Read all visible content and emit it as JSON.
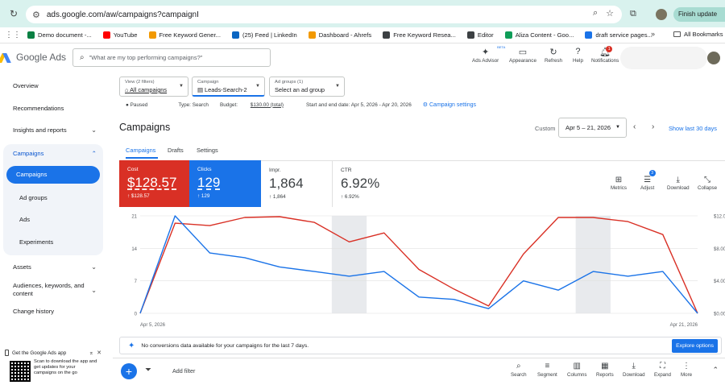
{
  "browser": {
    "url": "ads.google.com/aw/campaigns?campaignI",
    "finish_update": "Finish update"
  },
  "bookmarks": [
    {
      "label": "Demo document -...",
      "color": "#0b8043"
    },
    {
      "label": "YouTube",
      "color": "#ff0000"
    },
    {
      "label": "Free Keyword Gener...",
      "color": "#f29900"
    },
    {
      "label": "(25) Feed | LinkedIn",
      "color": "#0a66c2"
    },
    {
      "label": "Dashboard - Ahrefs",
      "color": "#f29900"
    },
    {
      "label": "Free Keyword Resea...",
      "color": "#3c4043"
    },
    {
      "label": "Editor",
      "color": "#3c4043"
    },
    {
      "label": "Aliza Content - Goo...",
      "color": "#0f9d58"
    },
    {
      "label": "draft service pages...",
      "color": "#1a73e8"
    }
  ],
  "bookmarks_all": "All Bookmarks",
  "header": {
    "brand": "Google Ads",
    "search_placeholder": "\"What are my top performing campaigns?\"",
    "tools": {
      "advisor": "Ads Advisor",
      "advisor_badge": "BETA",
      "appearance": "Appearance",
      "refresh": "Refresh",
      "help": "Help",
      "notifications": "Notifications",
      "notif_count": "1"
    }
  },
  "sidebar": {
    "overview": "Overview",
    "recommendations": "Recommendations",
    "insights": "Insights and reports",
    "campaigns_group": "Campaigns",
    "campaigns": "Campaigns",
    "ad_groups": "Ad groups",
    "ads": "Ads",
    "experiments": "Experiments",
    "assets": "Assets",
    "audiences": "Audiences, keywords, and content",
    "change_history": "Change history",
    "promo_title": "Get the Google Ads app",
    "promo_text": "Scan to download the app and get updates for your campaigns on the go"
  },
  "filters": {
    "view_label": "View (2 filters)",
    "view_value": "All campaigns",
    "campaign_label": "Campaign",
    "campaign_value": "Leads-Search-2",
    "adgroups_label": "Ad groups (1)",
    "adgroups_value": "Select an ad group"
  },
  "status": {
    "state": "Paused",
    "type": "Type: Search",
    "budget_prefix": "Budget:",
    "budget": "$130.00 (total)",
    "dates": "Start and end date: Apr 5, 2026 - Apr 20, 2026",
    "settings": "Campaign settings"
  },
  "page": {
    "title": "Campaigns",
    "custom": "Custom",
    "date_range": "Apr 5 – 21, 2026",
    "show_last": "Show last 30 days"
  },
  "tabs": [
    "Campaigns",
    "Drafts",
    "Settings"
  ],
  "metrics": [
    {
      "label": "Cost",
      "value": "$128.57",
      "delta": "$128.57"
    },
    {
      "label": "Clicks",
      "value": "129",
      "delta": "129"
    },
    {
      "label": "Impr.",
      "value": "1,864",
      "delta": "1,864"
    },
    {
      "label": "CTR",
      "value": "6.92%",
      "delta": "6.92%"
    }
  ],
  "card_tools": {
    "metrics": "Metrics",
    "adjust": "Adjust",
    "adjust_badge": "3",
    "download": "Download",
    "collapse": "Collapse"
  },
  "chart_data": {
    "type": "line",
    "x": [
      "Apr 5, 2026",
      "Apr 6",
      "Apr 7",
      "Apr 8",
      "Apr 9",
      "Apr 10",
      "Apr 11",
      "Apr 12",
      "Apr 13",
      "Apr 14",
      "Apr 15",
      "Apr 16",
      "Apr 17",
      "Apr 18",
      "Apr 19",
      "Apr 20",
      "Apr 21, 2026"
    ],
    "x_tick_labels": [
      "Apr 5, 2026",
      "Apr 21, 2026"
    ],
    "left_axis": {
      "ticks": [
        "21",
        "14",
        "7",
        "0"
      ],
      "ylim": [
        0,
        21
      ]
    },
    "right_axis": {
      "ticks": [
        "$12.00",
        "$8.00",
        "$4.00",
        "$0.00"
      ],
      "ylim": [
        0,
        12
      ]
    },
    "series": [
      {
        "axis": "right",
        "color": "#d93025",
        "values": [
          0,
          11.1,
          10.8,
          11.8,
          11.9,
          11.2,
          8.8,
          9.9,
          5.4,
          3.0,
          0.9,
          7.3,
          11.8,
          11.8,
          11.3,
          9.7,
          0
        ]
      },
      {
        "axis": "left",
        "color": "#1a73e8",
        "values": [
          0,
          21,
          13,
          12,
          10,
          9,
          8,
          9,
          3.5,
          3,
          1,
          7,
          5,
          9,
          8,
          9,
          0
        ]
      }
    ],
    "shaded_periods": [
      "Apr 11",
      "Apr 18"
    ],
    "grid": true
  },
  "notice": {
    "text": "No conversions data available for your campaigns for the last 7 days.",
    "button": "Explore options"
  },
  "bottom": {
    "add_filter": "Add filter",
    "search": "Search",
    "segment": "Segment",
    "columns": "Columns",
    "reports": "Reports",
    "download": "Download",
    "expand": "Expand",
    "more": "More"
  }
}
